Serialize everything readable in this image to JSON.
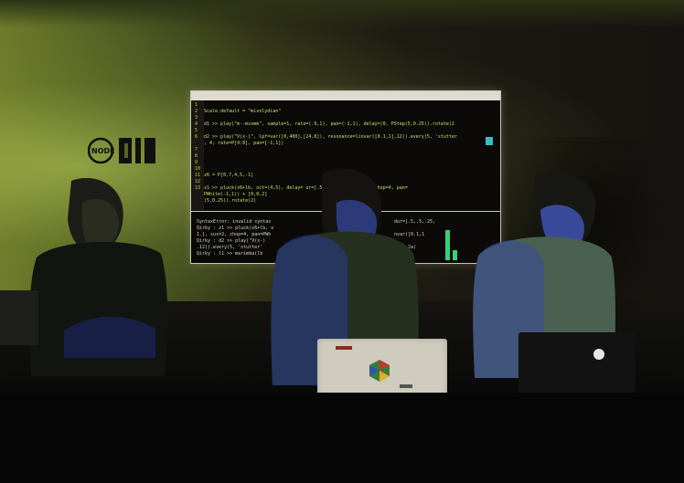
{
  "scene": {
    "description_colors": {
      "wall_left": "#6e7a2a",
      "wall_right": "#161410",
      "projection_bg": "#0b0a08",
      "code_green": "#c6e26a",
      "line_number_yellow": "#d8c84a"
    }
  },
  "logo": {
    "text": "NODE"
  },
  "projection": {
    "code_lines": [
      {
        "n": "1",
        "text": ""
      },
      {
        "n": "2",
        "text": "Scale.default = \"mixolydian\""
      },
      {
        "n": "3",
        "text": ""
      },
      {
        "n": "4",
        "text": "d1 >> play(\"m--mssmm\", sample=1, rate=(.9,1), pan=(-1,1), delay=(0, PStep(5,0.25)).rotate(2"
      },
      {
        "n": "5",
        "text": ""
      },
      {
        "n": "6",
        "text": "d2 >> play(\"V(x-)\", lpf=var([0,400],[24,8]), resonance=linvar([0.1,1],12)).every(5, 'stutter"
      },
      {
        "n": "",
        "text": ", 4, rate=P[4:8], pan=[-1,1])"
      },
      {
        "n": "7",
        "text": ""
      },
      {
        "n": "8",
        "text": ""
      },
      {
        "n": "9",
        "text": ""
      },
      {
        "n": "10",
        "text": ""
      },
      {
        "n": "11",
        "text": "z6 = P[0,7,4,5,-1]"
      },
      {
        "n": "12",
        "text": ""
      },
      {
        "n": "13",
        "text": "z1 >> pluck(z6+lb, oct=(4,5), delay=         ur=[.5,.5,.25,1], sus=1, chop=4, pan="
      },
      {
        "n": "",
        "text": "PWhite(-1,1)) + [0,0,2]"
      },
      {
        "n": "",
        "text": "(5,0.25)).rotate(2)"
      }
    ],
    "highlighted_line": "d1 >>",
    "console_lines": [
      "SyntaxError: invalid syntax",
      "Qirky : z1 >> pluck(z6+lb, o",
      "1.], sus=2, chop=4, pan=PWh",
      "Qirky : d2 >> play(\"V(x-)",
      ".12)).every(5, 'stutter'",
      "Qirky : l1 >> marimba(lb"
    ],
    "console_right_lines": [
      "dur=[.5,.5,.25,",
      "",
      "nvar([0.1,1",
      "",
      "(1c, 2a)"
    ],
    "meter_levels": [
      0.35,
      0.12
    ]
  },
  "laptops": [
    {
      "name": "center-laptop",
      "brand_sticker": ""
    },
    {
      "name": "right-laptop",
      "brand_sticker": ""
    }
  ]
}
